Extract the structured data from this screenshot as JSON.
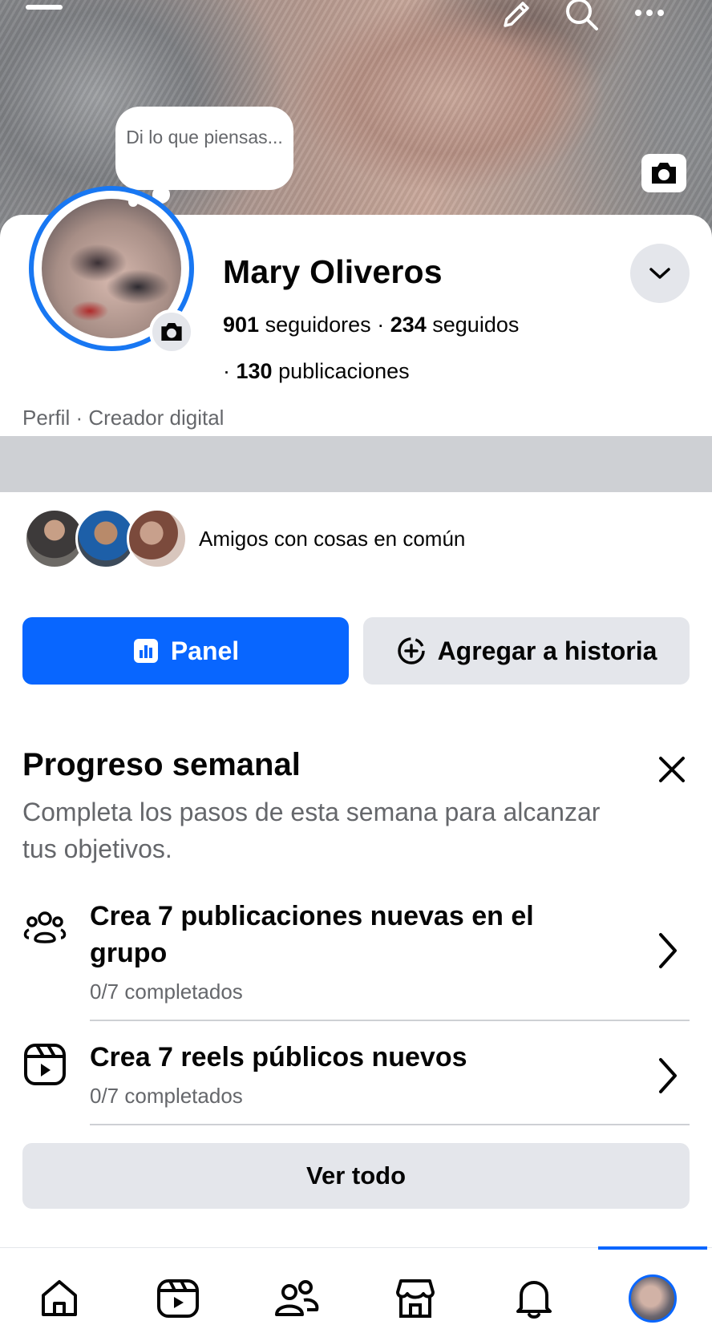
{
  "cover": {
    "bubble_text": "Di lo que piensas..."
  },
  "profile": {
    "name": "Mary Oliveros",
    "followers_count": "901",
    "followers_label": "seguidores",
    "following_count": "234",
    "following_label": "seguidos",
    "posts_count": "130",
    "posts_label": "publicaciones",
    "category": "Perfil · Creador digital"
  },
  "mutual_friends": {
    "text": "Amigos con cosas en común"
  },
  "actions": {
    "panel_label": "Panel",
    "add_story_label": "Agregar a historia"
  },
  "weekly_progress": {
    "title": "Progreso semanal",
    "subtitle": "Completa los pasos de esta semana para alcanzar tus objetivos.",
    "tasks": [
      {
        "title": "Crea 7 publicaciones nuevas en el grupo",
        "status": "0/7 completados",
        "icon": "group-icon"
      },
      {
        "title": "Crea 7 reels públicos nuevos",
        "status": "0/7 completados",
        "icon": "reels-icon"
      }
    ],
    "see_all_label": "Ver todo"
  },
  "bottom_nav": {
    "items": [
      "home-icon",
      "video-icon",
      "friends-icon",
      "marketplace-icon",
      "bell-icon",
      "profile-avatar"
    ],
    "active": "profile-avatar"
  },
  "colors": {
    "accent": "#0866ff",
    "ring": "#1877f2",
    "secondary_text": "#65676b",
    "button_gray": "#e4e6eb"
  }
}
